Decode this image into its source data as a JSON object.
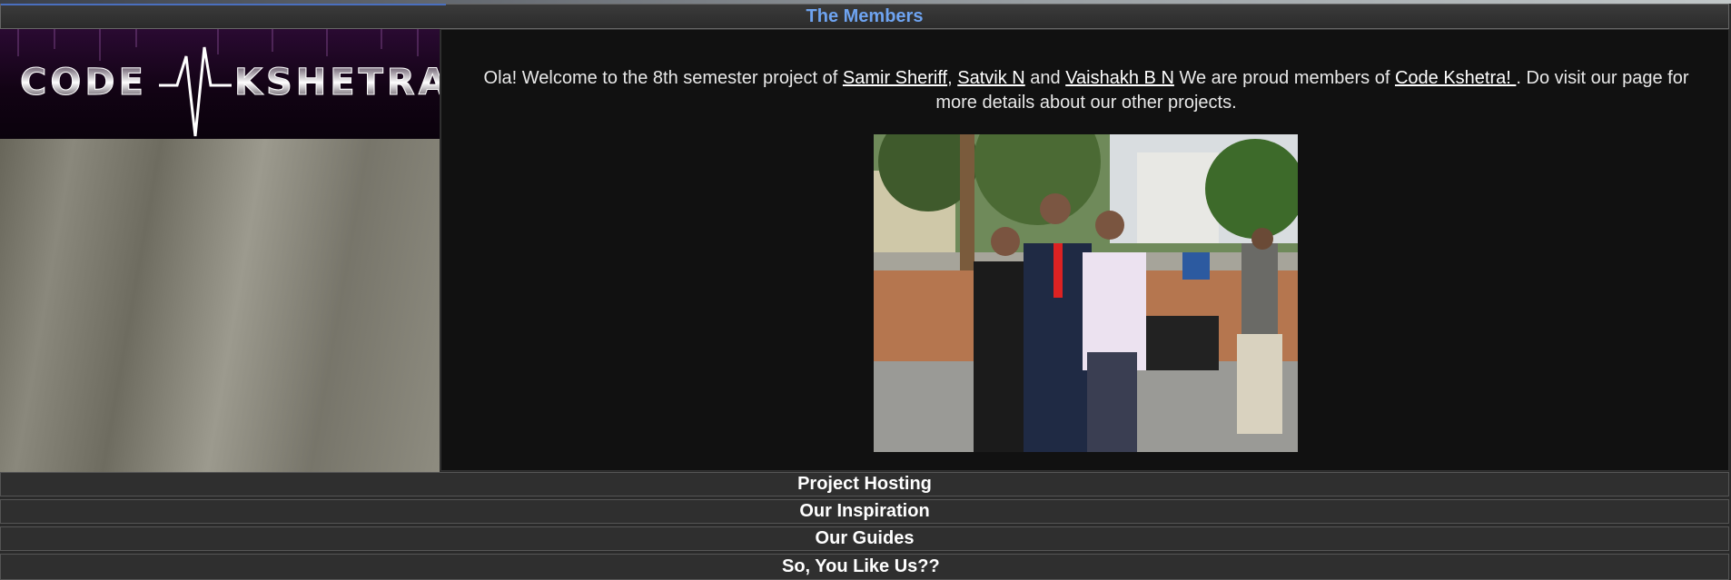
{
  "logo": {
    "text": "CODE KSHETRA"
  },
  "sections": {
    "members": "The Members",
    "project_hosting": "Project Hosting",
    "inspiration": "Our Inspiration",
    "guides": "Our Guides",
    "like_us": "So, You Like Us??"
  },
  "intro": {
    "part1": "Ola! Welcome to the 8th semester project of ",
    "name1": "Samir Sheriff",
    "sep1": ", ",
    "name2": "Satvik N",
    "sep2": " and ",
    "name3": "Vaishakh B N",
    "part2": " We are proud members of ",
    "org": "Code Kshetra! ",
    "part3": ". Do visit our page for more details about our other projects."
  },
  "colors": {
    "accent": "#6ea3f0",
    "header_bg": "#2f2f2f",
    "content_bg": "#111111"
  }
}
